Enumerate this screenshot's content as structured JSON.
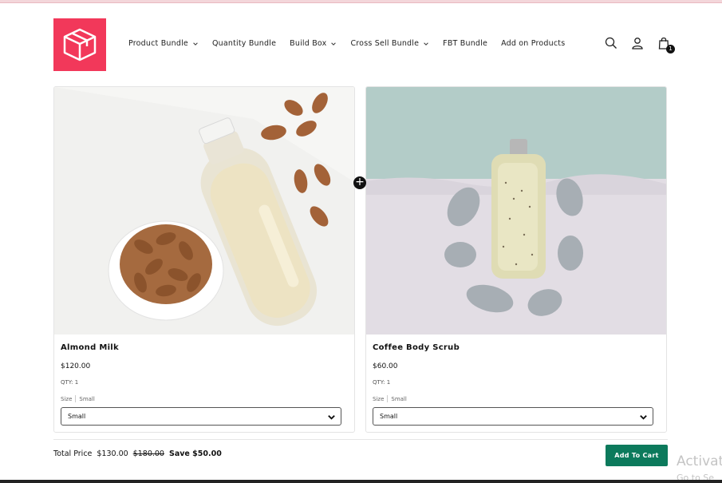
{
  "header": {
    "nav": [
      {
        "label": "Product Bundle",
        "dropdown": true
      },
      {
        "label": "Quantity Bundle",
        "dropdown": false
      },
      {
        "label": "Build Box",
        "dropdown": true
      },
      {
        "label": "Cross Sell Bundle",
        "dropdown": true
      },
      {
        "label": "FBT Bundle",
        "dropdown": false
      },
      {
        "label": "Add on Products",
        "dropdown": false
      }
    ],
    "icons": [
      "search-icon",
      "account-icon",
      "cart-icon"
    ],
    "cart_count": "1",
    "logo_color": "#f2385a"
  },
  "products": [
    {
      "title": "Almond Milk",
      "price": "$120.00",
      "qty": "QTY: 1",
      "size_label": "Size",
      "size_value": "Small",
      "select_value": "Small"
    },
    {
      "title": "Coffee Body Scrub",
      "price": "$60.00",
      "qty": "QTY: 1",
      "size_label": "Size",
      "size_value": "Small",
      "select_value": "Small"
    }
  ],
  "summary": {
    "label": "Total Price",
    "price": "$130.00",
    "old_price": "$180.00",
    "save": "Save $50.00",
    "button": "Add To Cart",
    "button_color": "#0c7a5c"
  },
  "watermark": {
    "line1": "Activat",
    "line2": "Go to Se"
  }
}
